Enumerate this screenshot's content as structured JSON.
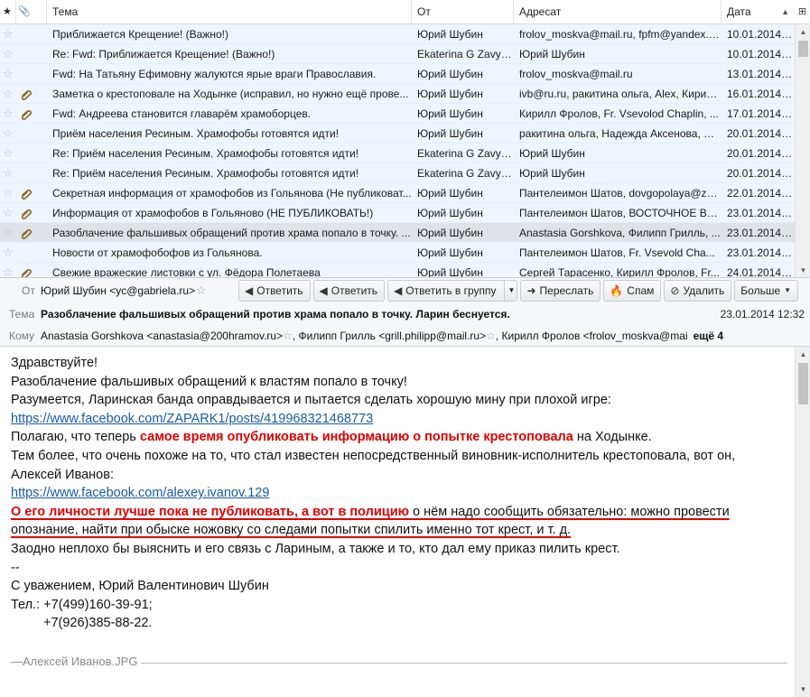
{
  "columns": {
    "star": "★",
    "attach": "📎",
    "subject": "Тема",
    "from": "От",
    "to": "Адресат",
    "date": "Дата"
  },
  "messages": [
    {
      "subject": "Приближается Крещение! (Важно!)",
      "from": "Юрий Шубин",
      "to": "frolov_moskva@mail.ru, fpfm@yandex.ru, ...",
      "date": "10.01.2014 1...",
      "att": false
    },
    {
      "subject": "Re: Fwd: Приближается Крещение! (Важно!)",
      "from": "Ekaterina G Zavyal...",
      "to": "Юрий Шубин",
      "date": "10.01.2014 2...",
      "att": false
    },
    {
      "subject": "Fwd: На Татьяну Ефимовну жалуются ярые враги Православия.",
      "from": "Юрий Шубин",
      "to": "frolov_moskva@mail.ru",
      "date": "13.01.2014 1...",
      "att": false
    },
    {
      "subject": "Заметка о крестоповале на Ходынке (исправил, но нужно ещё прове...",
      "from": "Юрий Шубин",
      "to": "ivb@ru.ru, ракитина ольга, Alex, Кирил...",
      "date": "16.01.2014 2...",
      "att": true
    },
    {
      "subject": "Fwd: Андреева становится главарём храмоборцев.",
      "from": "Юрий Шубин",
      "to": "Кирилл Фролов, Fr. Vsevolod Chaplin, ...",
      "date": "17.01.2014 1...",
      "att": true
    },
    {
      "subject": "Приём населения Ресиным. Храмофобы готовятся идти!",
      "from": "Юрий Шубин",
      "to": "ракитина ольга, Надежда Аксенова, Ek...",
      "date": "20.01.2014 9:...",
      "att": false
    },
    {
      "subject": "Re: Приём населения Ресиным. Храмофобы готовятся идти!",
      "from": "Ekaterina G Zavyal...",
      "to": "Юрий Шубин",
      "date": "20.01.2014 9:...",
      "att": false
    },
    {
      "subject": "Re: Приём населения Ресиным. Храмофобы готовятся идти!",
      "from": "Ekaterina G Zavyal...",
      "to": "Юрий Шубин",
      "date": "20.01.2014 1...",
      "att": false
    },
    {
      "subject": "Секретная информация от храмофобов из Гольянова (Не публиковат...",
      "from": "Юрий Шубин",
      "to": "Пантелеимон Шатов, dovgopolaya@ze...",
      "date": "22.01.2014 1...",
      "att": true
    },
    {
      "subject": "Информация от храмофобов в Гольяново (НЕ ПУБЛИКОВАТЬ!)",
      "from": "Юрий Шубин",
      "to": "Пантелеимон Шатов, ВОСТОЧНОЕ ВИ...",
      "date": "23.01.2014 9:...",
      "att": true
    },
    {
      "subject": "Разоблачение фальшивых обращений против храма попало в точку. ...",
      "from": "Юрий Шубин",
      "to": "Anastasia Gorshkova, Филипп Грилль, ...",
      "date": "23.01.2014 1...",
      "att": true,
      "selected": true
    },
    {
      "subject": "Новости от храмофобофов из Гольянова.",
      "from": "Юрий Шубин",
      "to": "Пантелеимон Шатов, Fr. Vsevold Cha...",
      "date": "23.01.2014 1...",
      "att": false
    },
    {
      "subject": "Свежие вражеские листовки с ул. Фёдора Полетаева",
      "from": "Юрий Шубин",
      "to": "Сергей Тарасенко, Кирилл Фролов, Fr...",
      "date": "24.01.2014 2...",
      "att": true
    }
  ],
  "header": {
    "from_label": "От",
    "from_value": "Юрий Шубин <yc@gabriela.ru>",
    "subject_label": "Тема",
    "subject_value": "Разоблачение фальшивых обращений против храма попало в точку. Ларин беснуется.",
    "date": "23.01.2014 12:32",
    "to_label": "Кому",
    "to_1": "Anastasia Gorshkova <anastasia@200hramov.ru>",
    "to_2": ", Филипп Грилль <grill.philipp@mail.ru>",
    "to_3": ", Кирилл Фролов <frolov_moskva@mai",
    "to_more": "ещё 4"
  },
  "toolbar": {
    "reply": "Ответить",
    "reply_all": "Ответить",
    "reply_group": "Ответить в группу",
    "forward": "Переслать",
    "spam": "Спам",
    "delete": "Удалить",
    "more": "Больше"
  },
  "body": {
    "l1": "Здравствуйте!",
    "l2": "Разоблачение фальшивых обращений к властям попало в точку!",
    "l3": "Разумеется, Ларинская банда оправдывается и пытается сделать хорошую мину при плохой игре:",
    "link1": "https://www.facebook.com/ZAPARK1/posts/419968321468773",
    "l5a": "Полагаю, что теперь ",
    "l5b": "самое время опубликовать информацию о попытке крестоповала",
    "l5c": " на Ходынке.",
    "l6": "Тем более, что очень похоже на то, что стал известен непосредственный виновник-исполнитель крестоповала, вот он,",
    "l7": "Алексей Иванов:",
    "link2": "https://www.facebook.com/alexey.ivanov.129",
    "l9a": "О его личности лучше пока не публиковать,",
    "l9b": " ",
    "l9c": "а вот в полицию",
    "l9d": " о нём надо сообщить обязательно: можно провести",
    "l10": "опознание, найти при обыске ножовку со следами попытки спилить именно тот крест, и т. д.",
    "l11": "Заодно неплохо бы выяснить и его связь с Лариным, а также и то, кто дал ему приказ пилить крест.",
    "l12": "--",
    "l13": "С уважением, Юрий Валентинович Шубин",
    "l14": "Тел.: +7(499)160-39-91;",
    "l15": "+7(926)385-88-22.",
    "attachment": "Алексей Иванов.JPG"
  },
  "colors": {
    "row_bg": "#eef5fc",
    "selected_row": "#dfe3e8",
    "link": "#1a5aa8",
    "highlight_red": "#e00000"
  }
}
